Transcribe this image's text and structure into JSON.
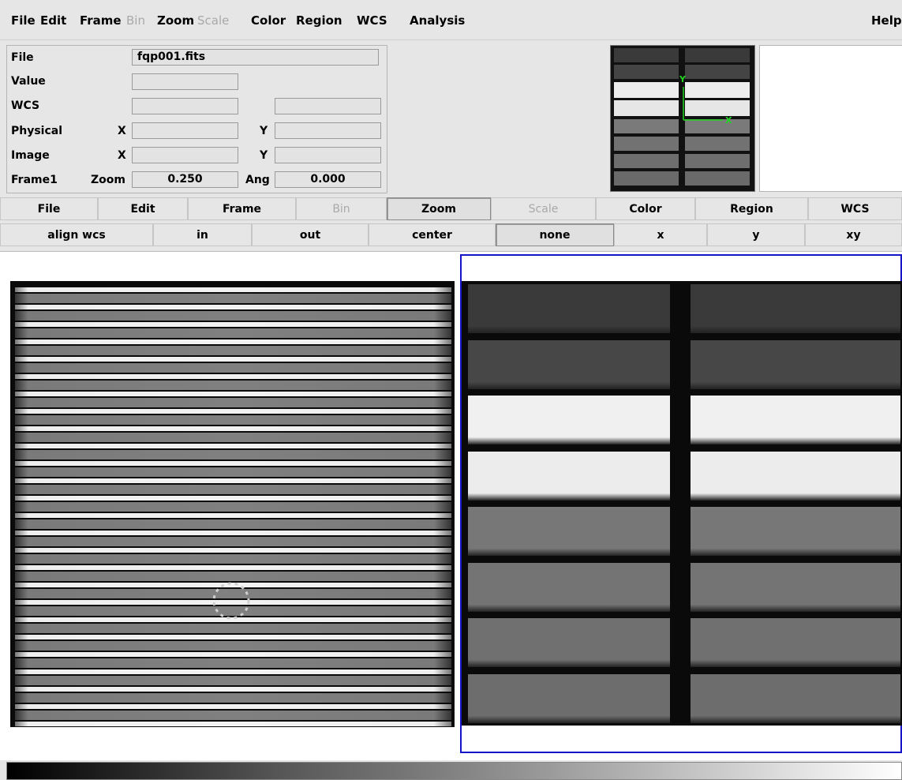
{
  "menubar": {
    "items": [
      {
        "label": "File",
        "disabled": false
      },
      {
        "label": "Edit",
        "disabled": false
      },
      {
        "label": "Frame",
        "disabled": false
      },
      {
        "label": "Bin",
        "disabled": true
      },
      {
        "label": "Zoom",
        "disabled": false
      },
      {
        "label": "Scale",
        "disabled": true
      },
      {
        "label": "Color",
        "disabled": false
      },
      {
        "label": "Region",
        "disabled": false
      },
      {
        "label": "WCS",
        "disabled": false
      },
      {
        "label": "Analysis",
        "disabled": false
      }
    ],
    "help": "Help"
  },
  "info": {
    "file_label": "File",
    "file_value": "fqp001.fits",
    "value_label": "Value",
    "value_value": "",
    "wcs_label": "WCS",
    "wcs_value1": "",
    "wcs_value2": "",
    "physical_label": "Physical",
    "physical_x_label": "X",
    "physical_x": "",
    "physical_y_label": "Y",
    "physical_y": "",
    "image_label": "Image",
    "image_x_label": "X",
    "image_x": "",
    "image_y_label": "Y",
    "image_y": "",
    "frame_label": "Frame1",
    "zoom_label": "Zoom",
    "zoom_value": "0.250",
    "ang_label": "Ang",
    "ang_value": "0.000"
  },
  "panner": {
    "compass_y": "Y",
    "compass_x": "X",
    "compass_color": "#22d322"
  },
  "buttonbar": {
    "row1": [
      {
        "label": "File",
        "disabled": false,
        "pressed": false
      },
      {
        "label": "Edit",
        "disabled": false,
        "pressed": false
      },
      {
        "label": "Frame",
        "disabled": false,
        "pressed": false
      },
      {
        "label": "Bin",
        "disabled": true,
        "pressed": false
      },
      {
        "label": "Zoom",
        "disabled": false,
        "pressed": true
      },
      {
        "label": "Scale",
        "disabled": true,
        "pressed": false
      },
      {
        "label": "Color",
        "disabled": false,
        "pressed": false
      },
      {
        "label": "Region",
        "disabled": false,
        "pressed": false
      },
      {
        "label": "WCS",
        "disabled": false,
        "pressed": false
      }
    ],
    "row2": [
      {
        "label": "align wcs",
        "pressed": false
      },
      {
        "label": "in",
        "pressed": false
      },
      {
        "label": "out",
        "pressed": false
      },
      {
        "label": "center",
        "pressed": false
      },
      {
        "label": "none",
        "pressed": true
      },
      {
        "label": "x",
        "pressed": false
      },
      {
        "label": "y",
        "pressed": false
      },
      {
        "label": "xy",
        "pressed": false
      }
    ]
  },
  "colors": {
    "frame_highlight": "#1515c8",
    "background": "#e6e6e6"
  }
}
